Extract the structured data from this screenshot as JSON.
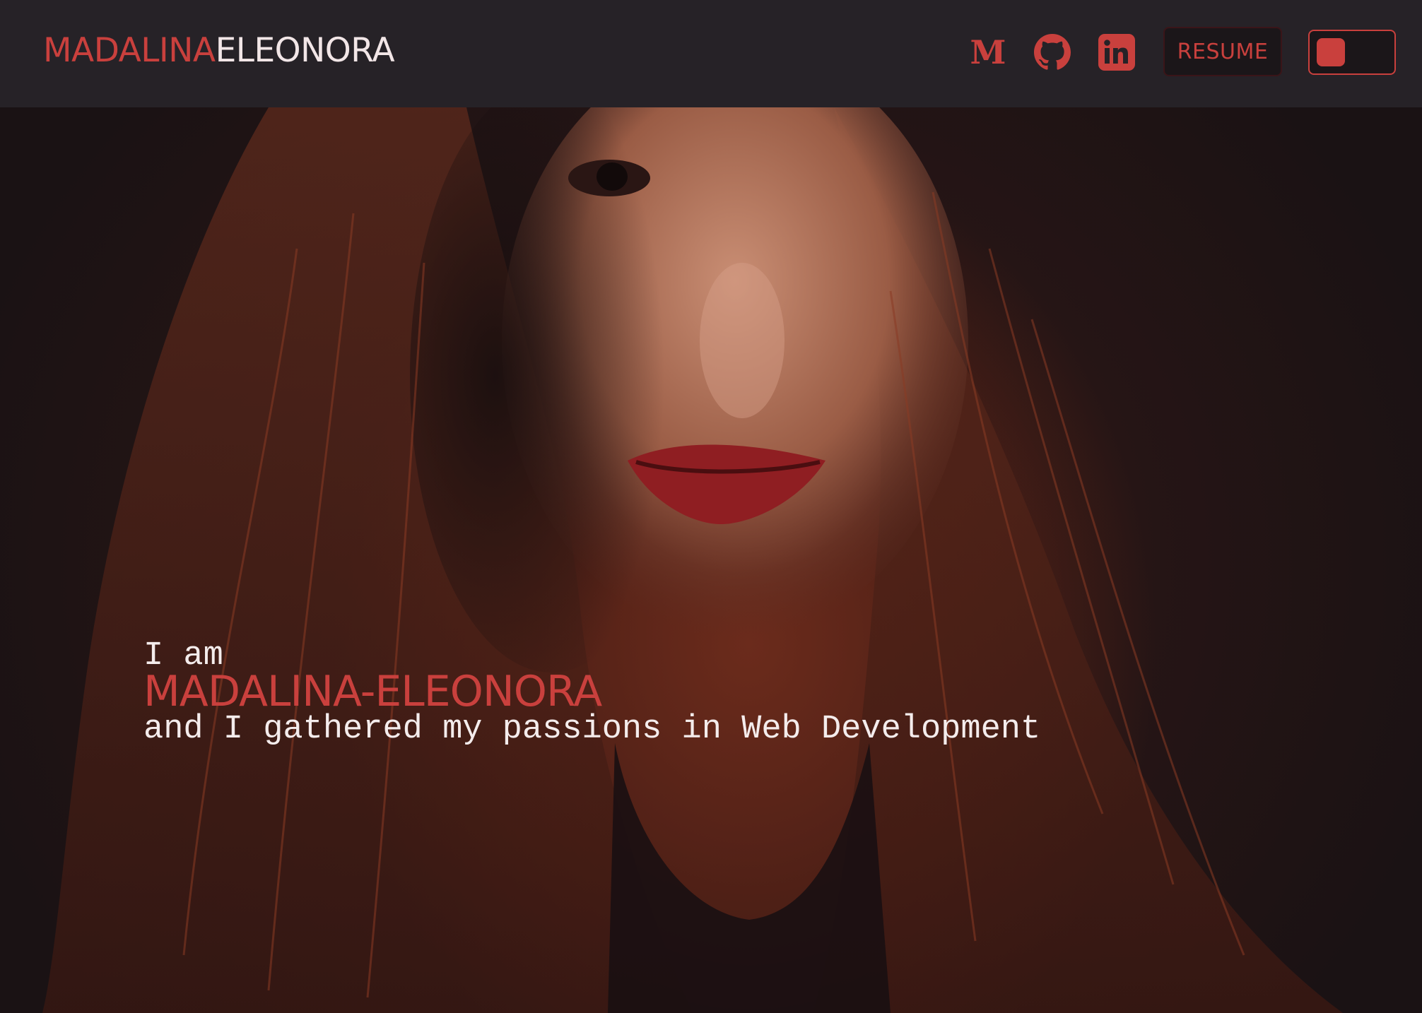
{
  "header": {
    "logo_first": "MADALINA",
    "logo_last": "ELEONORA",
    "social": {
      "medium_icon": "medium-icon",
      "github_icon": "github-icon",
      "linkedin_icon": "linkedin-icon"
    },
    "resume_label": "RESUME",
    "theme_toggle_icon": "theme-toggle"
  },
  "hero": {
    "greeting": "I am",
    "name": "MADALINA-ELEONORA",
    "tagline": "and I gathered my passions in Web Development"
  },
  "colors": {
    "accent": "#c9403d",
    "header_bg": "#262227",
    "text_light": "#f4ecec"
  }
}
